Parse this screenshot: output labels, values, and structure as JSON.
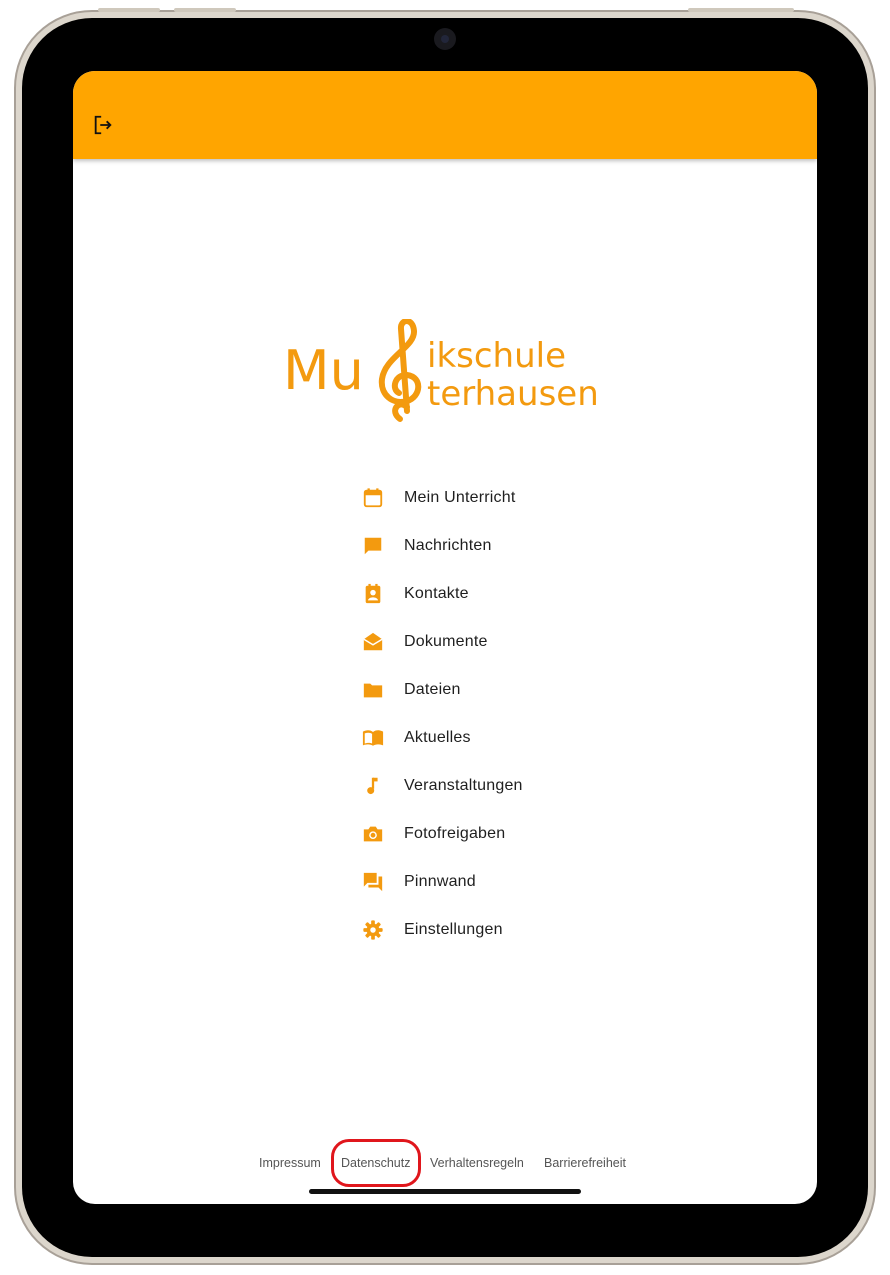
{
  "theme": {
    "accent": "#ffa500",
    "icon_color": "#f39a0f",
    "highlight": "#e0161c"
  },
  "logo": {
    "text_line1_left": "Mu",
    "text_line1_right": "ikschule",
    "text_line2_right": "terhausen",
    "color": "#f39a0f"
  },
  "app_bar": {
    "logout_icon": "logout-icon"
  },
  "menu": {
    "items": [
      {
        "label": "Mein Unterricht",
        "icon": "calendar-icon"
      },
      {
        "label": "Nachrichten",
        "icon": "message-icon"
      },
      {
        "label": "Kontakte",
        "icon": "contacts-icon"
      },
      {
        "label": "Dokumente",
        "icon": "envelope-open-icon"
      },
      {
        "label": "Dateien",
        "icon": "folder-icon"
      },
      {
        "label": "Aktuelles",
        "icon": "book-icon"
      },
      {
        "label": "Veranstaltungen",
        "icon": "music-note-icon"
      },
      {
        "label": "Fotofreigaben",
        "icon": "camera-icon"
      },
      {
        "label": "Pinnwand",
        "icon": "forum-icon"
      },
      {
        "label": "Einstellungen",
        "icon": "gear-icon"
      }
    ]
  },
  "footer": {
    "links": [
      "Impressum",
      "Datenschutz",
      "Verhaltensregeln",
      "Barrierefreiheit"
    ]
  }
}
